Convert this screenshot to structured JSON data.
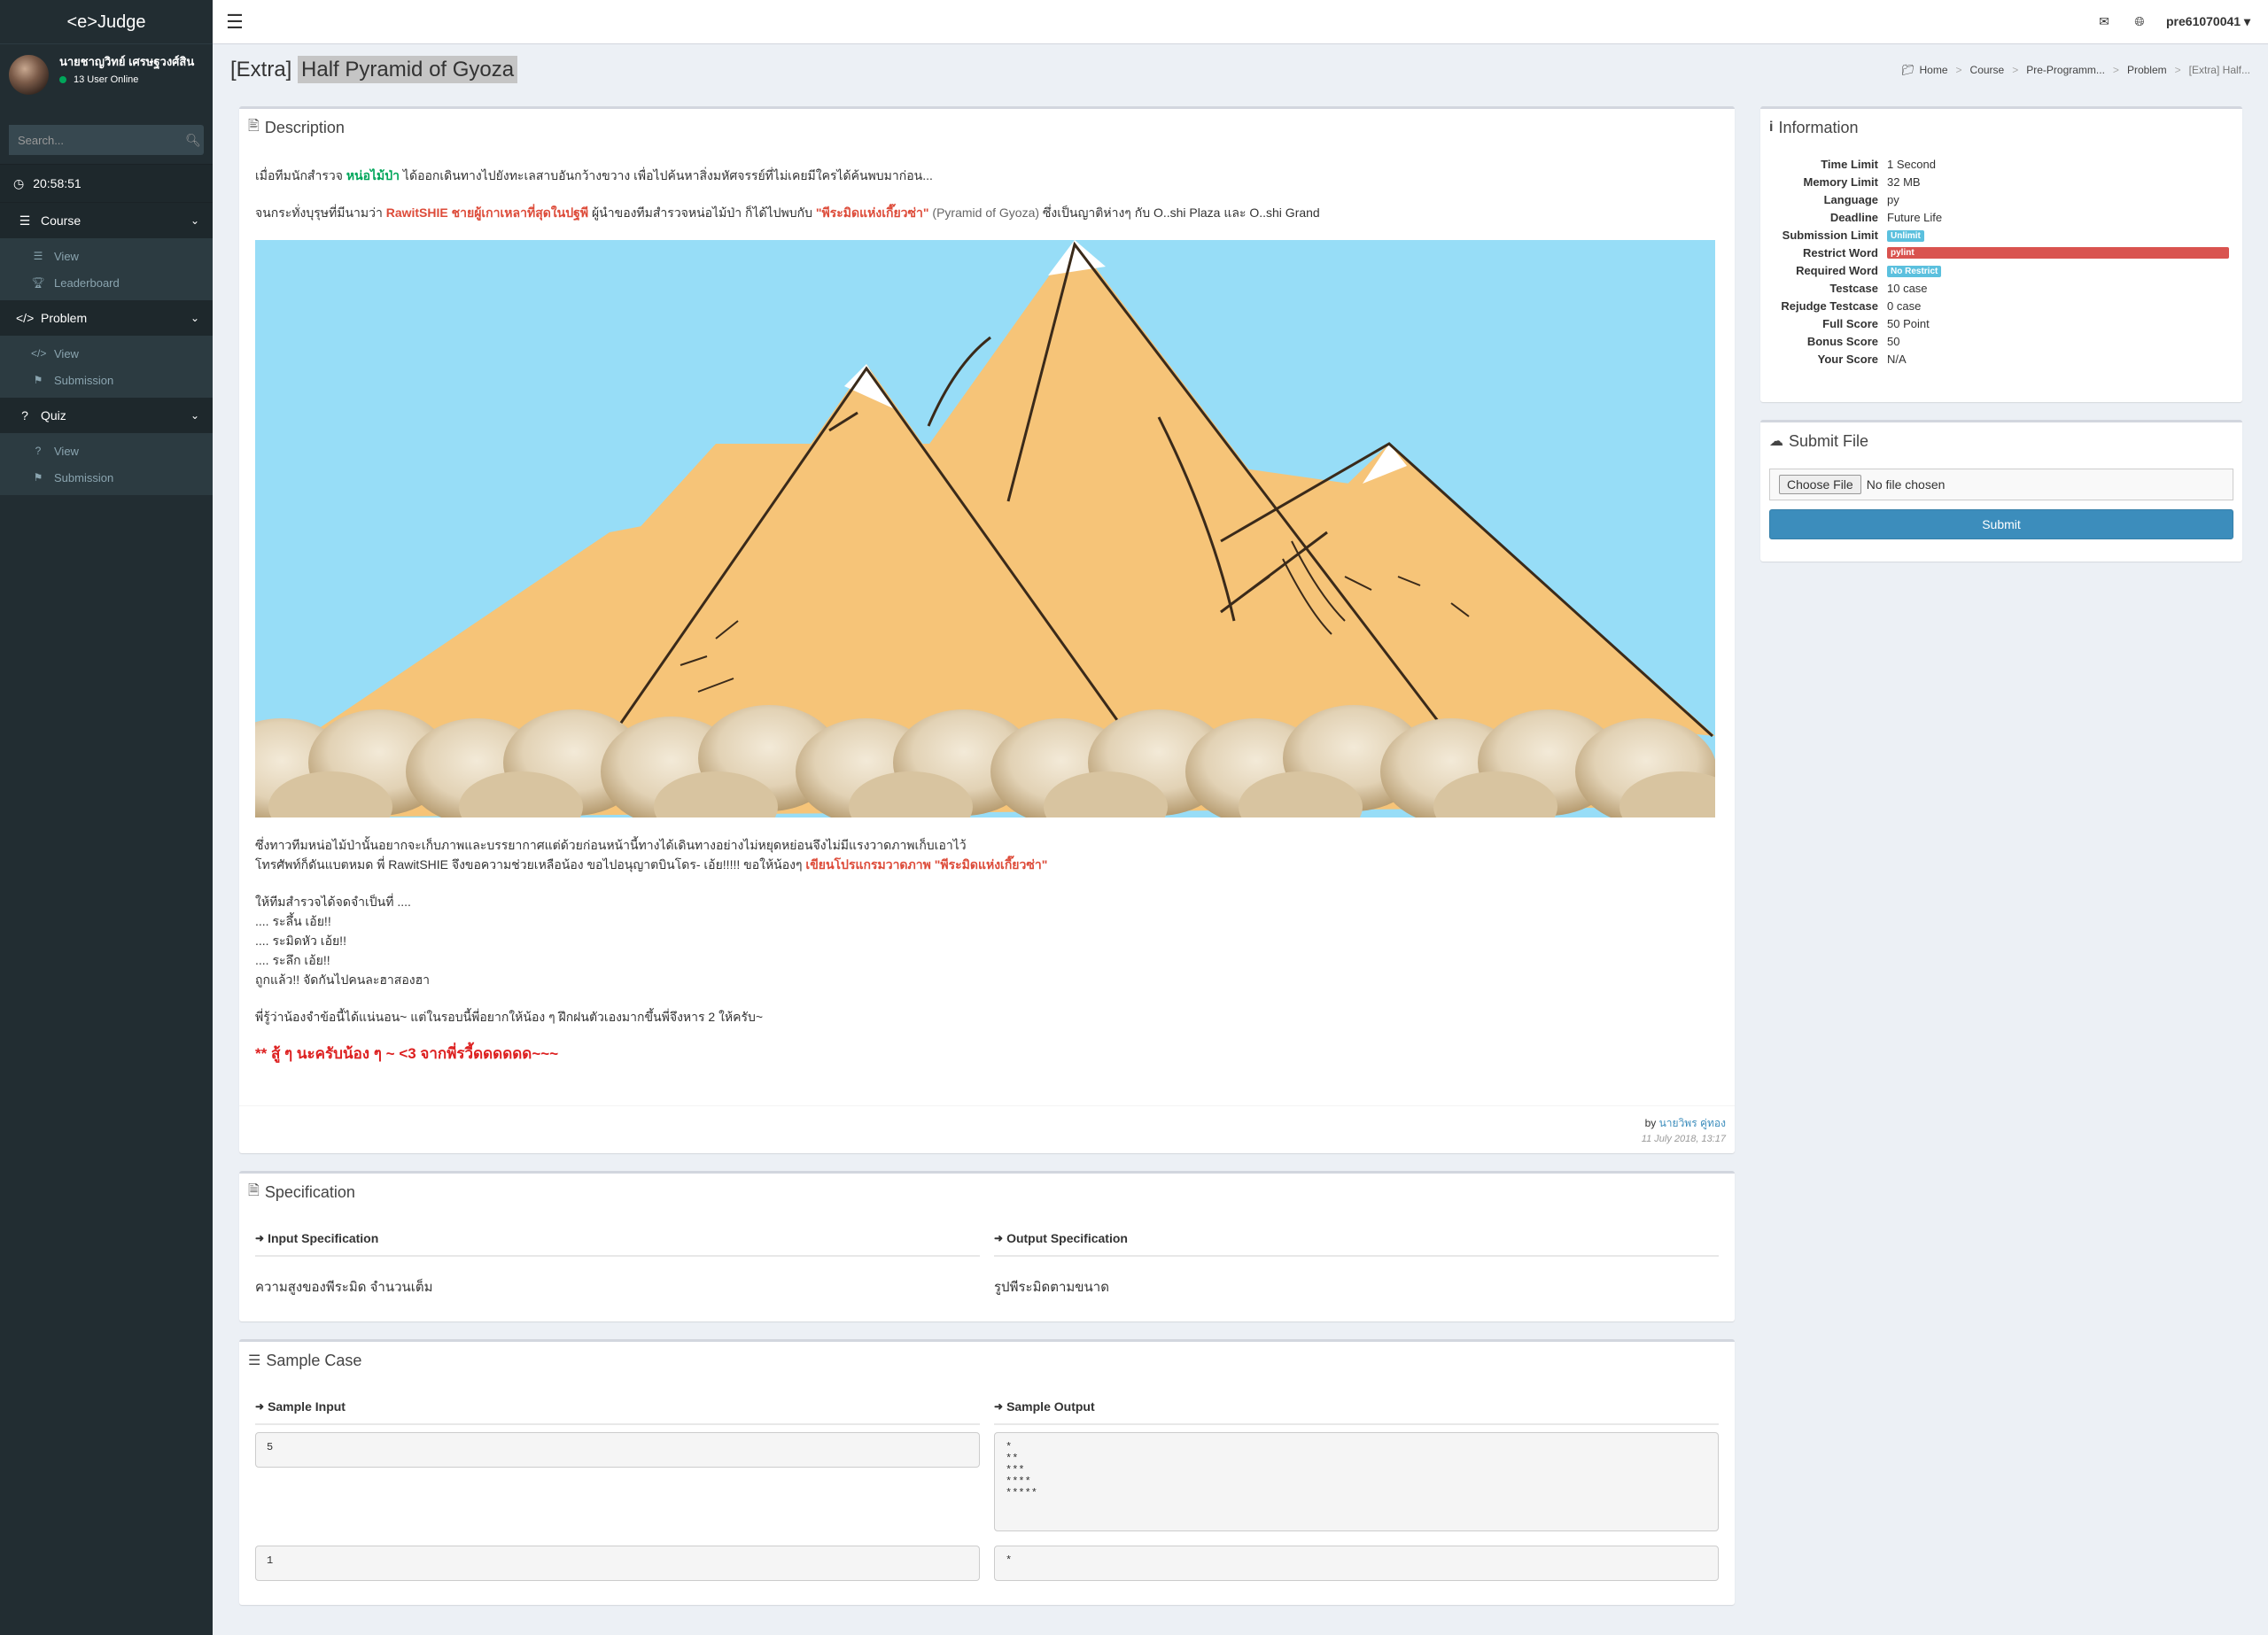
{
  "brand": "<e>Judge",
  "user": {
    "name": "นายชาญวิทย์ เศรษฐวงศ์สิน",
    "status": "13 User Online"
  },
  "search": {
    "placeholder": "Search..."
  },
  "clock": "20:58:51",
  "menu": {
    "course": {
      "label": "Course",
      "items": [
        "View",
        "Leaderboard"
      ]
    },
    "problem": {
      "label": "Problem",
      "items": [
        "View",
        "Submission"
      ]
    },
    "quiz": {
      "label": "Quiz",
      "items": [
        "View",
        "Submission"
      ]
    }
  },
  "navbar": {
    "username": "pre61070041"
  },
  "title": {
    "prefix": "[Extra]",
    "name": "Half Pyramid of Gyoza"
  },
  "breadcrumb": [
    "Home",
    "Course",
    "Pre-Programm...",
    "Problem",
    "[Extra] Half..."
  ],
  "description": {
    "header": "Description",
    "p1_a": "เมื่อทีมนักสำรวจ ",
    "p1_b": "หน่อไม้ป่า",
    "p1_c": " ได้ออกเดินทางไปยังทะเลสาบอันกว้างขวาง เพื่อไปค้นหาสิ่งมหัศจรรย์ที่ไม่เคยมีใครได้ค้นพบมาก่อน...",
    "p2_a": "จนกระทั่งบุรุษที่มีนามว่า ",
    "p2_b": "RawitSHIE ชายผู้เกาเหลาที่สุดในปฐพี",
    "p2_c": " ผู้นำของทีมสำรวจหน่อไม้ป่า ก็ได้ไปพบกับ ",
    "p2_d": "\"พีระมิดแห่งเกี๊ยวซ่า\"",
    "p2_e": " (Pyramid of Gyoza)",
    "p2_f": " ซึ่งเป็นญาติห่างๆ กับ O..shi Plaza และ O..shi Grand",
    "p3_line1": "ซึ่งทาวทีมหน่อไม้ป่านั้นอยากจะเก็บภาพและบรรยากาศแต่ด้วยก่อนหน้านี้ทางได้เดินทางอย่างไม่หยุดหย่อนจึงไม่มีแรงวาดภาพเก็บเอาไว้",
    "p3_line2": "โทรศัพท์ก็ดันแบตหมด พี่ RawitSHIE จึงขอความช่วยเหลือน้อง ขอไปอนุญาตบินโดร- เอ้ย!!!!! ขอให้น้องๆ ",
    "p3_line2_red": "เขียนโปรแกรมวาดภาพ \"พีระมิดแห่งเกี๊ยวซ่า\"",
    "p4": [
      "ให้ทีมสำรวจได้จดจำเป็นที่ ....",
      ".... ระลึ้น เอ้ย!!",
      ".... ระมิดหัว เอ้ย!!",
      ".... ระลึก เอ้ย!!",
      "ถูกแล้ว!! จัดกันไปคนละฮาสองฮา"
    ],
    "p5": "พี่รู้ว่าน้องจำข้อนี้ได้แน่นอน~ แต่ในรอบนี้พี่อยากให้น้อง ๆ ฝึกฝนตัวเองมากขึ้นพี่จึงหาร 2 ให้ครับ~",
    "p6": "** สู้ ๆ นะครับน้อง ๆ ~ <3 จากพี่รวี้ดดดดดด~~~",
    "by": "by",
    "author": "นายวิพร คู่ทอง",
    "date": "11 July 2018, 13:17"
  },
  "information": {
    "header": "Information",
    "rows": [
      {
        "label": "Time Limit",
        "value": "1 Second"
      },
      {
        "label": "Memory Limit",
        "value": "32 MB"
      },
      {
        "label": "Language",
        "value": "py"
      },
      {
        "label": "Deadline",
        "value": "Future Life"
      },
      {
        "label": "Submission Limit",
        "value": "Unlimit"
      },
      {
        "label": "Restrict Word",
        "value": "pylint"
      },
      {
        "label": "Required Word",
        "value": "No Restrict"
      },
      {
        "label": "Testcase",
        "value": "10 case"
      },
      {
        "label": "Rejudge Testcase",
        "value": "0 case"
      },
      {
        "label": "Full Score",
        "value": "50 Point"
      },
      {
        "label": "Bonus Score",
        "value": "50"
      },
      {
        "label": "Your Score",
        "value": "N/A"
      }
    ]
  },
  "submit": {
    "header": "Submit File",
    "choose": "Choose File",
    "nofile": "No file chosen",
    "button": "Submit"
  },
  "specification": {
    "header": "Specification",
    "input_head": "Input Specification",
    "output_head": "Output Specification",
    "input_text": "ความสูงของพีระมิด จำนวนเต็ม",
    "output_text": "รูปพีระมิดตามขนาด"
  },
  "sample": {
    "header": "Sample Case",
    "input_head": "Sample Input",
    "output_head": "Sample Output",
    "cases": [
      {
        "input": "5",
        "output": "*\n**\n***\n****\n*****"
      },
      {
        "input": "1",
        "output": "*"
      }
    ]
  },
  "colors": {
    "sidebar": "#222d32",
    "primary": "#3c8dbc",
    "danger": "#d9534f",
    "info": "#5bc0de",
    "success": "#00a65a"
  }
}
